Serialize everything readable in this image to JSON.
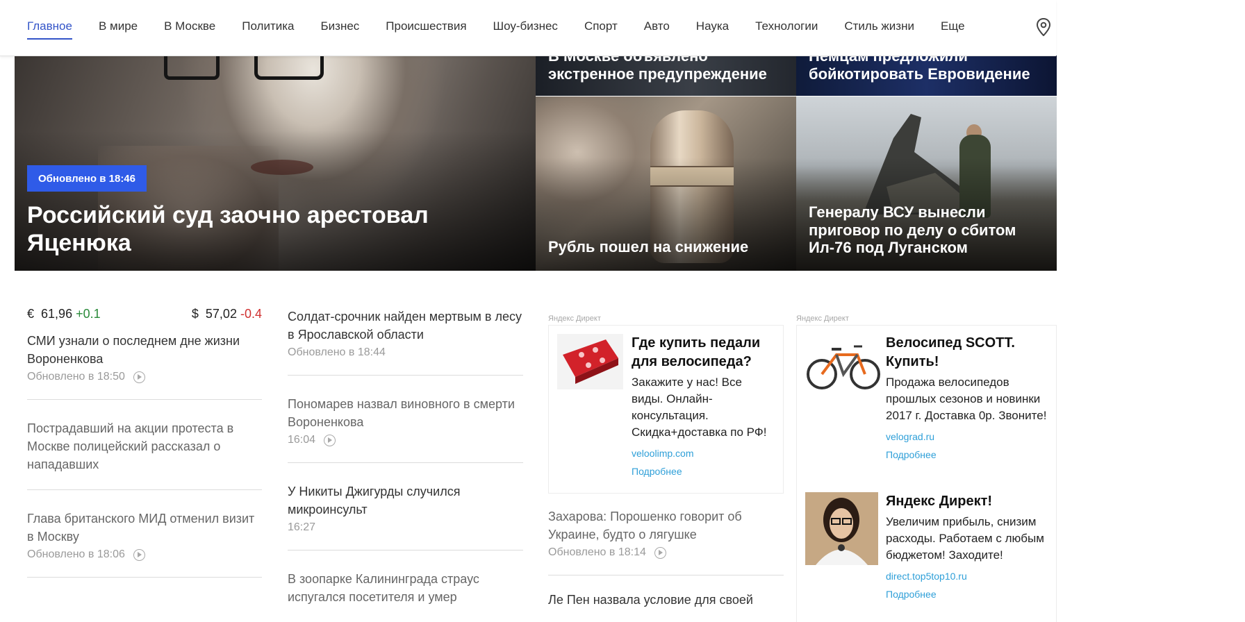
{
  "nav": {
    "items": [
      "Главное",
      "В мире",
      "В Москве",
      "Политика",
      "Бизнес",
      "Происшествия",
      "Шоу-бизнес",
      "Спорт",
      "Авто",
      "Наука",
      "Технологии",
      "Стиль жизни",
      "Еще"
    ],
    "active_index": 0
  },
  "hero": {
    "main": {
      "badge": "Обновлено в 18:46",
      "title": "Российский суд заочно арестовал Яценюка"
    },
    "top_left": {
      "title": "В Москве объявлено экстренное предупреждение"
    },
    "top_right": {
      "title": "Немцам предложили бойкотировать Евровидение"
    },
    "ruble": {
      "title": "Рубль пошел на снижение"
    },
    "plane": {
      "title": "Генералу ВСУ вынесли приговор по делу о сбитом Ил-76 под Луганском"
    }
  },
  "rates": {
    "eur": {
      "symbol": "€",
      "value": "61,96",
      "change": "+0.1"
    },
    "usd": {
      "symbol": "$",
      "value": "57,02",
      "change": "-0.4"
    }
  },
  "col1": [
    {
      "title": "СМИ узнали о последнем дне жизни Вороненкова",
      "meta": "Обновлено в 18:50",
      "video": true
    },
    {
      "title": "Пострадавший на акции протеста в Москве полицейский рассказал о нападавших",
      "meta": "",
      "video": false
    },
    {
      "title": "Глава британского МИД отменил визит в Москву",
      "meta": "Обновлено в 18:06",
      "video": true
    }
  ],
  "col2": [
    {
      "title": "Солдат-срочник найден мертвым в лесу в Ярославской области",
      "meta": "Обновлено в 18:44",
      "video": false
    },
    {
      "title": "Пономарев назвал виновного в смерти Вороненкова",
      "meta": "16:04",
      "video": true
    },
    {
      "title": "У Никиты Джигурды случился микроинсульт",
      "meta": "16:27",
      "video": false
    },
    {
      "title": "В зоопарке Калининграда страус испугался посетителя и умер",
      "meta": "",
      "video": false
    }
  ],
  "ads_label": "Яндекс Директ",
  "ad1": {
    "title": "Где купить педали для велосипеда?",
    "text": "Закажите у нас! Все виды. Онлайн-консультация. Скидка+доставка по РФ!",
    "url": "veloolimp.com",
    "more": "Подробнее"
  },
  "col3_news": [
    {
      "title": "Захарова: Порошенко говорит об Украине, будто о лягушке",
      "meta": "Обновлено в 18:14",
      "video": true
    },
    {
      "title": "Ле Пен назвала условие для своей",
      "meta": "",
      "video": false
    }
  ],
  "ad2": {
    "title": "Велосипед SCOTT. Купить!",
    "text": "Продажа велосипедов прошлых сезонов и новинки 2017 г. Доставка 0р. Звоните!",
    "url": "velograd.ru",
    "more": "Подробнее"
  },
  "ad3": {
    "title": "Яндекс Директ!",
    "text": "Увеличим прибыль, снизим расходы. Работаем с любым бюджетом! Заходите!",
    "url": "direct.top5top10.ru",
    "more": "Подробнее"
  },
  "colors": {
    "accent": "#3354c8",
    "badge": "#2f5be8",
    "up": "#2a8a3a",
    "down": "#d03030",
    "ad_link": "#2e9fd8"
  }
}
